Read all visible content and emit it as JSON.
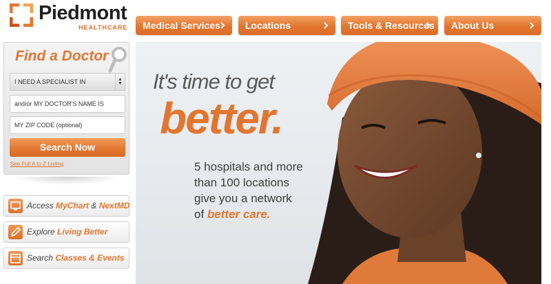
{
  "brand": {
    "name": "Piedmont",
    "subtitle": "HEALTHCARE",
    "accent_color": "#e27630"
  },
  "nav": {
    "items": [
      {
        "label": "Medical Services"
      },
      {
        "label": "Locations"
      },
      {
        "label": "Tools & Resources"
      },
      {
        "label": "About Us"
      }
    ]
  },
  "finder": {
    "title": "Find a Doctor",
    "specialist_select": "I NEED A SPECIALIST IN",
    "doctor_name_placeholder": "and/or MY DOCTOR'S NAME IS",
    "zip_placeholder": "MY ZIP CODE (optional)",
    "search_label": "Search Now",
    "a2z_link": "See Full A to Z Listing"
  },
  "quick_links": [
    {
      "prefix": "Access ",
      "bold1": "MyChart",
      "mid": " & ",
      "bold2": "NextMD",
      "icon": "computer-icon"
    },
    {
      "prefix": "Explore ",
      "bold1": "Living Better",
      "mid": "",
      "bold2": "",
      "icon": "pencil-icon"
    },
    {
      "prefix": "Search ",
      "bold1": "Classes & Events",
      "mid": "",
      "bold2": "",
      "icon": "calendar-icon"
    }
  ],
  "hero": {
    "tagline_1": "It's time to get",
    "tagline_2": "better.",
    "blurb_line_1": "5 hospitals and more",
    "blurb_line_2": "than 100 locations",
    "blurb_line_3": "give you a network",
    "blurb_line_4_prefix": "of ",
    "blurb_line_4_accent": "better care."
  }
}
